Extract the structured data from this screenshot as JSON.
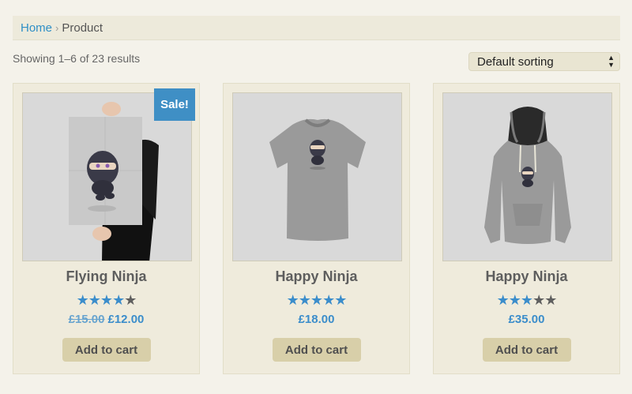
{
  "breadcrumb": {
    "home": "Home",
    "separator": "›",
    "current": "Product"
  },
  "result_count": "Showing 1–6 of 23 results",
  "sorting": {
    "selected": "Default sorting"
  },
  "products": [
    {
      "title": "Flying Ninja",
      "rating": 4,
      "old_price": "£15.00",
      "price": "£12.00",
      "sale": "Sale!",
      "cart": "Add to cart",
      "image": "ninja-poster"
    },
    {
      "title": "Happy Ninja",
      "rating": 5,
      "old_price": "",
      "price": "£18.00",
      "cart": "Add to cart",
      "image": "ninja-tshirt"
    },
    {
      "title": "Happy Ninja",
      "rating": 3,
      "old_price": "",
      "price": "£35.00",
      "cart": "Add to cart",
      "image": "ninja-hoodie"
    }
  ],
  "colors": {
    "accent": "#3b8dcb",
    "background": "#f4f2ea",
    "card": "#efebdc",
    "button": "#d8cfa9"
  }
}
